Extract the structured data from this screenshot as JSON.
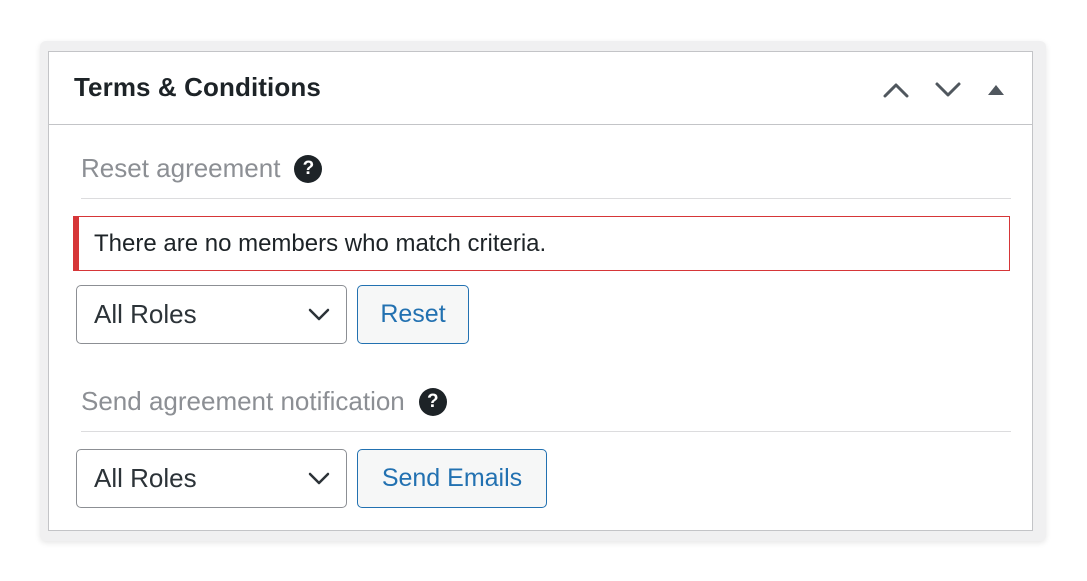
{
  "panel": {
    "title": "Terms & Conditions",
    "header_icons": [
      "chevron-up-icon",
      "chevron-down-icon",
      "triangle-up-icon"
    ]
  },
  "reset_section": {
    "label": "Reset agreement",
    "help_icon": "?",
    "notice": "There are no members who match criteria.",
    "notice_color": "#d63638",
    "select_value": "All Roles",
    "button_label": "Reset"
  },
  "send_section": {
    "label": "Send agreement notification",
    "help_icon": "?",
    "select_value": "All Roles",
    "button_label": "Send Emails"
  },
  "colors": {
    "accent": "#2271b1",
    "border": "#c3c4c7",
    "muted_text": "#8c8f94",
    "text": "#1d2327"
  }
}
